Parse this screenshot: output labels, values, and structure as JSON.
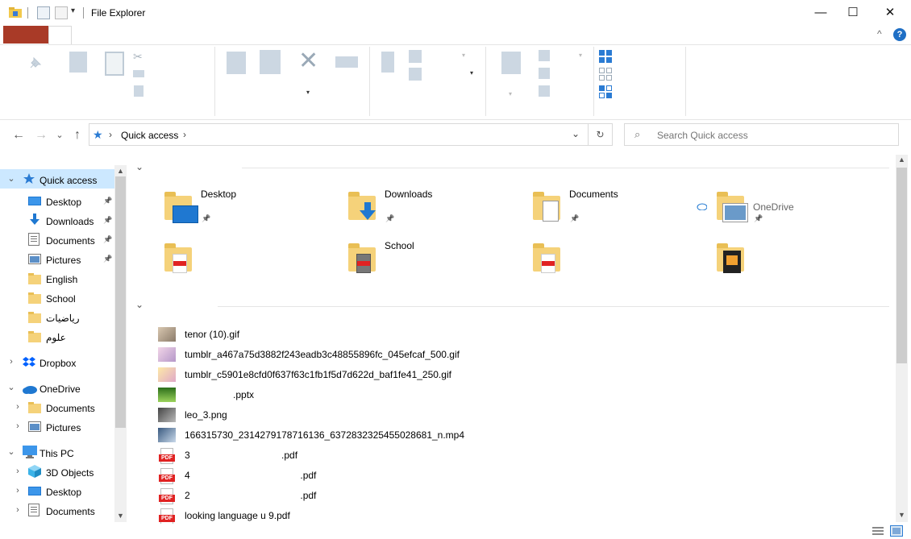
{
  "window": {
    "title": "File Explorer",
    "minimize": "—",
    "maximize": "☐",
    "close": "✕"
  },
  "ribbon": {
    "help": "?",
    "collapse": "^"
  },
  "nav": {
    "back": "←",
    "forward": "→",
    "recent": "⌄",
    "up": "↑"
  },
  "address": {
    "root_arrow": "›",
    "location": "Quick access",
    "trail_arrow": "›",
    "dropdown": "⌄",
    "refresh": "↻"
  },
  "search": {
    "placeholder": "Search Quick access"
  },
  "sidebar": {
    "items": [
      {
        "label": "Quick access",
        "chevron": "⌄",
        "pinned": false
      },
      {
        "label": "Desktop",
        "pinned": true
      },
      {
        "label": "Downloads",
        "pinned": true
      },
      {
        "label": "Documents",
        "pinned": true
      },
      {
        "label": "Pictures",
        "pinned": true
      },
      {
        "label": "English",
        "pinned": false
      },
      {
        "label": "School",
        "pinned": false
      },
      {
        "label": "رياضيات",
        "pinned": false
      },
      {
        "label": "علوم",
        "pinned": false
      },
      {
        "label": "Dropbox",
        "chevron": "›"
      },
      {
        "label": "OneDrive",
        "chevron": "⌄"
      },
      {
        "label": "Documents",
        "chevron": "›"
      },
      {
        "label": "Pictures",
        "chevron": "›"
      },
      {
        "label": "This PC",
        "chevron": "⌄"
      },
      {
        "label": "3D Objects",
        "chevron": "›"
      },
      {
        "label": "Desktop",
        "chevron": "›"
      },
      {
        "label": "Documents",
        "chevron": "›"
      }
    ]
  },
  "frequent": {
    "toggle": "⌄",
    "folders": [
      {
        "label": "Desktop",
        "pinned": true
      },
      {
        "label": "Downloads",
        "pinned": true
      },
      {
        "label": "Documents",
        "pinned": true
      },
      {
        "label": "OneDrive",
        "pinned": true,
        "cloud": true
      },
      {
        "label": "",
        "pinned": false
      },
      {
        "label": "School",
        "pinned": false
      },
      {
        "label": "",
        "pinned": false
      },
      {
        "label": "",
        "pinned": false
      }
    ]
  },
  "recent": {
    "toggle": "⌄",
    "files": [
      {
        "name": "tenor (10).gif",
        "type": "image"
      },
      {
        "name": "tumblr_a467a75d3882f243eadb3c48855896fc_045efcaf_500.gif",
        "type": "image"
      },
      {
        "name": "tumblr_c5901e8cfd0f637f63c1fb1f5d7d622d_baf1fe41_250.gif",
        "type": "image"
      },
      {
        "name": "                  .pptx",
        "type": "pptx"
      },
      {
        "name": "leo_3.png",
        "type": "image"
      },
      {
        "name": "166315730_2314279178716136_6372832325455028681_n.mp4",
        "type": "video"
      },
      {
        "name": "3                                  .pdf",
        "type": "pdf"
      },
      {
        "name": "4                                         .pdf",
        "type": "pdf"
      },
      {
        "name": "2                                         .pdf",
        "type": "pdf"
      },
      {
        "name": "looking language u 9.pdf",
        "type": "pdf"
      }
    ]
  },
  "pdf_badge": "PDF",
  "colors": {
    "accent": "#1f6fc5",
    "file_tab": "#a93a27",
    "folder": "#f5d27a",
    "selection": "#cce8ff"
  }
}
